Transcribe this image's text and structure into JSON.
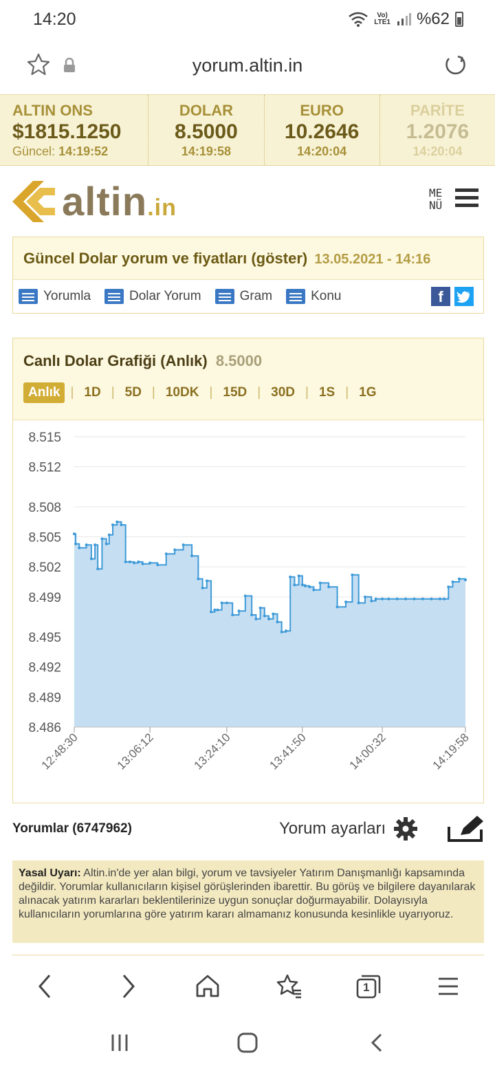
{
  "status": {
    "time": "14:20",
    "network": "LTE1",
    "battery": "%62"
  },
  "browser": {
    "url": "yorum.altin.in"
  },
  "ticker": [
    {
      "name": "ALTIN ONS",
      "value": "$1815.1250",
      "time_label": "Güncel:",
      "time": "14:19:52"
    },
    {
      "name": "DOLAR",
      "value": "8.5000",
      "time_label": "",
      "time": "14:19:58"
    },
    {
      "name": "EURO",
      "value": "10.2646",
      "time_label": "",
      "time": "14:20:04"
    },
    {
      "name": "PARİTE",
      "value": "1.2076",
      "time_label": "",
      "time": "14:20:04"
    }
  ],
  "logo": {
    "main": "altin",
    "suffix": ".in"
  },
  "menu": {
    "line1": "ME",
    "line2": "NÜ"
  },
  "heading": {
    "title": "Güncel Dolar yorum ve fiyatları (göster)",
    "date": "13.05.2021 - 14:16",
    "links": [
      "Yorumla",
      "Dolar Yorum",
      "Gram",
      "Konu"
    ]
  },
  "chart_box": {
    "title": "Canlı Dolar Grafiği (Anlık)",
    "value": "8.5000",
    "ranges": [
      "Anlık",
      "1D",
      "5D",
      "10DK",
      "15D",
      "30D",
      "1S",
      "1G"
    ],
    "active_range": "Anlık"
  },
  "chart_data": {
    "type": "area",
    "title": "",
    "xlabel": "",
    "ylabel": "",
    "ylim": [
      8.486,
      8.515
    ],
    "yticks": [
      "8.515",
      "8.512",
      "8.508",
      "8.505",
      "8.502",
      "8.499",
      "8.495",
      "8.492",
      "8.489",
      "8.486"
    ],
    "xticks": [
      "12:48:30",
      "13:06:12",
      "13:24:10",
      "13:41:50",
      "14:00:32",
      "14:19:58"
    ],
    "grid": true,
    "color": "#3e9ad8",
    "fill": "#c5def2",
    "x": [
      "12:48:30",
      "12:48:50",
      "12:49:40",
      "12:51:20",
      "12:52:30",
      "12:53:20",
      "12:54:00",
      "12:55:00",
      "12:56:00",
      "12:56:40",
      "12:57:30",
      "12:58:30",
      "12:59:30",
      "13:00:30",
      "13:01:30",
      "13:02:30",
      "13:03:30",
      "13:04:30",
      "13:06:12",
      "13:08:00",
      "13:10:00",
      "13:12:00",
      "13:14:00",
      "13:16:00",
      "13:17:30",
      "13:18:30",
      "13:19:30",
      "13:20:30",
      "13:21:20",
      "13:22:00",
      "13:23:00",
      "13:24:10",
      "13:25:30",
      "13:27:00",
      "13:28:30",
      "13:30:00",
      "13:31:00",
      "13:32:00",
      "13:33:00",
      "13:34:00",
      "13:35:00",
      "13:36:00",
      "13:37:00",
      "13:38:00",
      "13:39:00",
      "13:40:00",
      "13:41:00",
      "13:41:50",
      "13:42:30",
      "13:43:30",
      "13:44:30",
      "13:46:00",
      "13:48:00",
      "13:50:00",
      "13:52:00",
      "13:53:30",
      "13:55:00",
      "13:56:30",
      "13:58:00",
      "13:59:00",
      "14:00:32",
      "14:02:00",
      "14:04:00",
      "14:06:00",
      "14:08:00",
      "14:10:00",
      "14:12:00",
      "14:14:00",
      "14:15:00",
      "14:16:00",
      "14:17:00",
      "14:18:30",
      "14:19:58"
    ],
    "values": [
      8.5053,
      8.5043,
      8.5039,
      8.5042,
      8.5028,
      8.5042,
      8.5018,
      8.5048,
      8.5043,
      8.5052,
      8.5062,
      8.5065,
      8.5062,
      8.5025,
      8.5025,
      8.5024,
      8.5025,
      8.5023,
      8.5024,
      8.5022,
      8.5033,
      8.5037,
      8.5042,
      8.5031,
      8.5008,
      8.4999,
      8.5006,
      8.4975,
      8.4977,
      8.4977,
      8.4984,
      8.4984,
      8.4972,
      8.4976,
      8.4991,
      8.4972,
      8.4968,
      8.4979,
      8.4971,
      8.4968,
      8.4973,
      8.4965,
      8.4955,
      8.4956,
      8.501,
      8.5002,
      8.5011,
      8.5002,
      8.5001,
      8.5,
      8.4997,
      8.5004,
      8.5,
      8.498,
      8.4985,
      8.5012,
      8.4984,
      8.499,
      8.4986,
      8.4988,
      8.4988,
      8.4988,
      8.4988,
      8.4988,
      8.4988,
      8.4988,
      8.4988,
      8.4988,
      8.4988,
      8.5,
      8.5005,
      8.5008,
      8.5007
    ]
  },
  "comments": {
    "count_label": "Yorumlar (6747962)",
    "settings_label": "Yorum ayarları"
  },
  "legal": {
    "label": "Yasal Uyarı:",
    "text": " Altin.in'de yer alan bilgi, yorum ve tavsiyeler Yatırım Danışmanlığı kapsamında değildir. Yorumlar kullanıcıların kişisel görüşlerinden ibarettir. Bu görüş ve bilgilere dayanılarak alınacak yatırım kararları beklentilerinize uygun sonuçlar doğurmayabilir. Dolayısıyla kullanıcıların yorumlarına göre yatırım kararı almamanız konusunda kesinlikle uyarıyoruz."
  },
  "browser_nav": {
    "tab_count": "1"
  }
}
